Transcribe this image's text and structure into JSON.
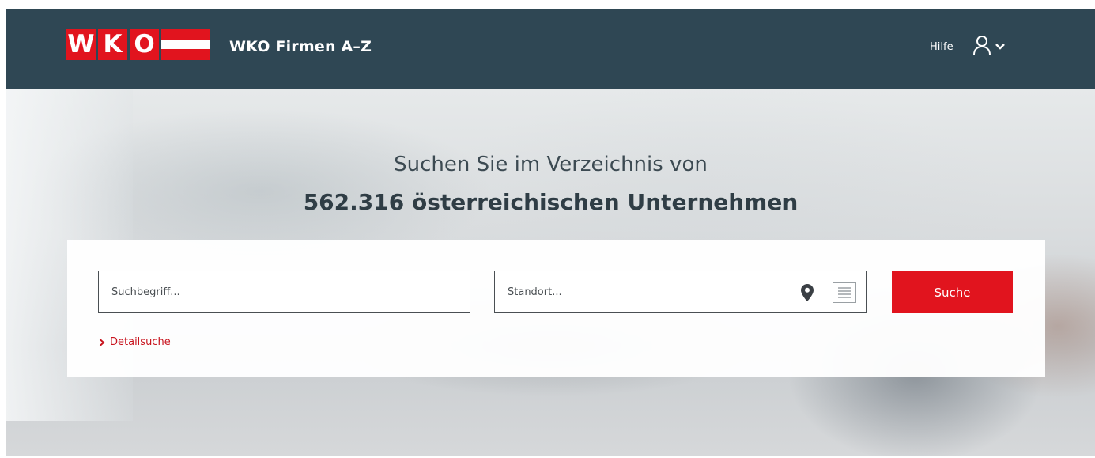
{
  "header": {
    "logo_letters": [
      "W",
      "K",
      "O"
    ],
    "app_title": "WKO Firmen A–Z",
    "help_label": "Hilfe"
  },
  "hero": {
    "headline_line1": "Suchen Sie im Verzeichnis von",
    "headline_line2": "562.316 österreichischen Unternehmen"
  },
  "search": {
    "keyword_placeholder": "Suchbegriff...",
    "keyword_value": "",
    "location_placeholder": "Standort...",
    "location_value": "",
    "submit_label": "Suche",
    "detail_search_label": "Detailsuche"
  },
  "colors": {
    "header_bg": "#2f4754",
    "brand_red": "#e1141e",
    "link_red": "#c8141e"
  },
  "icons": {
    "user": "user-icon",
    "dropdown": "chevron-down-icon",
    "location": "map-pin-icon",
    "list": "list-icon",
    "detail": "chevron-right-icon"
  }
}
